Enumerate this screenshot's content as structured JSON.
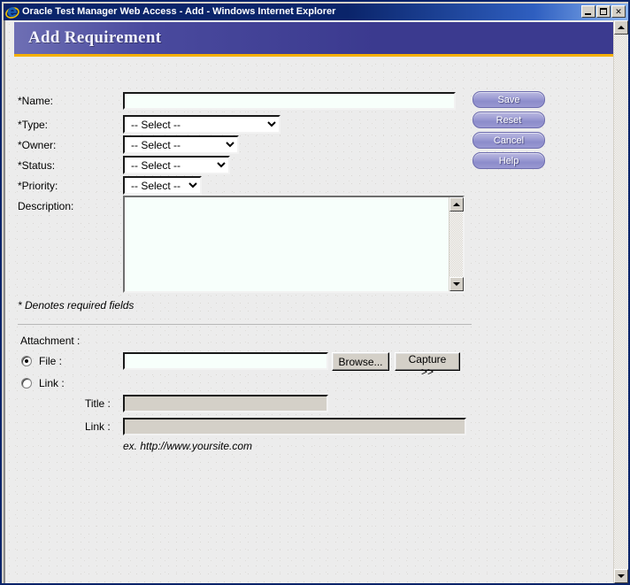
{
  "window": {
    "title": "Oracle Test Manager Web Access - Add - Windows Internet Explorer",
    "icon": "internet-explorer-icon",
    "minimize_label": "Minimize",
    "maximize_label": "Maximize",
    "close_label": "✕"
  },
  "banner": {
    "title": "Add Requirement",
    "accent_color": "#3b3a8f",
    "underline_color": "#f5b000"
  },
  "form": {
    "fields": [
      {
        "label": "*Name:",
        "type": "text",
        "value": ""
      },
      {
        "label": "*Type:",
        "type": "select",
        "value": "-- Select --"
      },
      {
        "label": "*Owner:",
        "type": "select",
        "value": "-- Select --"
      },
      {
        "label": "*Status:",
        "type": "select",
        "value": "-- Select --"
      },
      {
        "label": "*Priority:",
        "type": "select",
        "value": "-- Select --"
      },
      {
        "label": "Description:",
        "type": "textarea",
        "value": ""
      }
    ],
    "select_placeholder": "-- Select --",
    "required_note": "* Denotes required fields"
  },
  "actions": {
    "save": "Save",
    "reset": "Reset",
    "cancel": "Cancel",
    "help": "Help"
  },
  "attachment": {
    "heading": "Attachment :",
    "file_label": "File :",
    "file_value": "",
    "file_selected": true,
    "browse_label": "Browse...",
    "capture_label": "Capture >>",
    "link_label": "Link :",
    "link_selected": false,
    "title_label": "Title :",
    "title_value": "",
    "link_field_label": "Link :",
    "link_field_value": "",
    "example_text": "ex. http://www.yoursite.com"
  }
}
